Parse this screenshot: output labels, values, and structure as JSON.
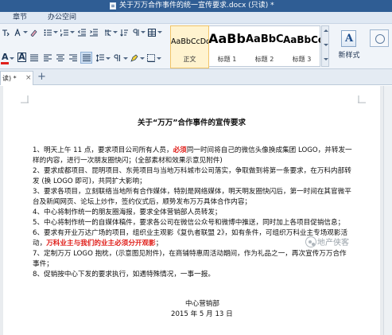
{
  "window": {
    "title": "关于万万合作事件的统一宣传要求.docx (只读) *"
  },
  "menu": {
    "tabs": [
      "章节",
      "办公空间"
    ]
  },
  "ribbon": {
    "styles": [
      {
        "sample": "AaBbCcDd",
        "name": "正文"
      },
      {
        "sample": "AaBb",
        "name": "标题 1"
      },
      {
        "sample": "AaBbC",
        "name": "标题 2"
      },
      {
        "sample": "AaBbCc",
        "name": "标题 3"
      }
    ],
    "new_style_label": "新样式",
    "font_color_letter": "A",
    "highlight_letter": "A",
    "text_color": "#e0201b",
    "highlight_color": "#ffe100"
  },
  "doc_tab": {
    "label": "读) *",
    "close": "×",
    "new_tab": "+"
  },
  "document": {
    "title": "关于“万万”合作事件的宣传要求",
    "lines": [
      [
        {
          "t": "1、明天上午 11 点，要求项目公司所有人员，"
        },
        {
          "t": "必须",
          "red": true
        },
        {
          "t": "同一时间将自己的微信头像换成集团 LOGO，并转发一"
        }
      ],
      [
        {
          "t": "样的内容，进行一次朋友圈快闪；(全部素材和效果示意见附件)"
        }
      ],
      [
        {
          "t": "2、要求成都项目、昆明项目、东莞项目与当地万科城市公司落实，争取做到将第一条要求，在万科内部转"
        }
      ],
      [
        {
          "t": "发 (换 LOGO 即可)，共同扩大影响；"
        }
      ],
      [
        {
          "t": "3、要求各项目，立刻联络当地所有合作媒体，特别是网络媒体，明天明友圈快闪后，第一时间在其官微平"
        }
      ],
      [
        {
          "t": "台及新闻网页、论坛上炒作，签约仪式后，顺势发布万万具体合作内容；"
        }
      ],
      [
        {
          "t": "4、中心将制作统一的朋友圈海报，要求全体营销部人员转发；"
        }
      ],
      [
        {
          "t": "5、中心将制作统一的自媒体稿件，要求各公司在微信公众号和微博中推送，同时加上各项目促销信息；"
        }
      ],
      [
        {
          "t": "6、要求有开业万达广场的项目，组织业主观影《复仇者联盟 2》，如有条件，可组织万科业主专场观影活"
        }
      ],
      [
        {
          "t": "动，"
        },
        {
          "t": "万科业主与我们的业主必须分开观影",
          "red": true
        },
        {
          "t": "；"
        }
      ],
      [
        {
          "t": "7、定制万万 LOGO 抱枕，(示意图见附件)，在商铺特惠周活动期间，作为礼品之一，再次宣传万万合作"
        }
      ],
      [
        {
          "t": "事件；"
        }
      ],
      [
        {
          "t": "8、促销按中心下发的要求执行，如遇特殊情况，一事一报。"
        }
      ]
    ],
    "signature": "中心营销部",
    "date": "2015 年 5 月 13 日"
  },
  "watermark": {
    "text": "地产侠客",
    "icon": "wechat-icon"
  }
}
